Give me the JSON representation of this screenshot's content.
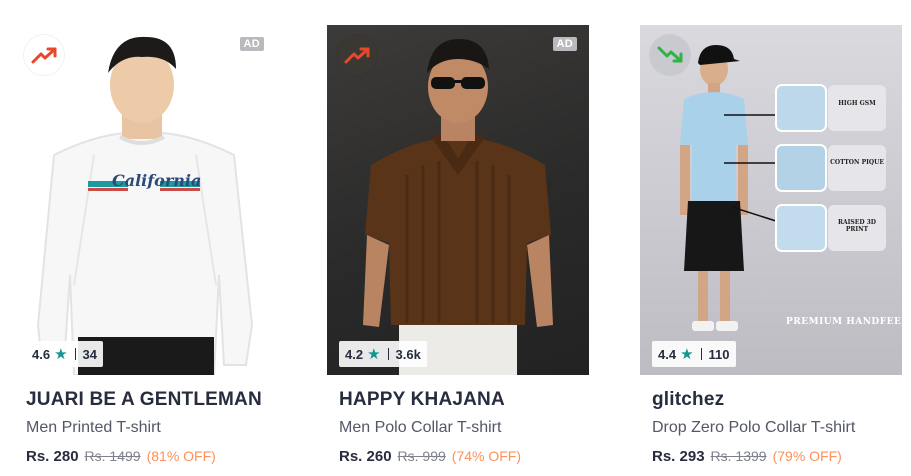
{
  "products": [
    {
      "trend_icon": "trending-up-icon",
      "trend_color": "#e8472c",
      "ad_label": "AD",
      "rating": "4.6",
      "rating_count": "34",
      "brand": "JUARI BE A GENTLEMAN",
      "name": "Men Printed T-shirt",
      "price": "Rs. 280",
      "mrp": "Rs. 1499",
      "discount": "(81% OFF)",
      "print_text": "California"
    },
    {
      "trend_icon": "trending-up-icon",
      "trend_color": "#e8472c",
      "ad_label": "AD",
      "rating": "4.2",
      "rating_count": "3.6k",
      "brand": "HAPPY KHAJANA",
      "name": "Men Polo Collar T-shirt",
      "price": "Rs. 260",
      "mrp": "Rs. 999",
      "discount": "(74% OFF)"
    },
    {
      "trend_icon": "trending-down-icon",
      "trend_color": "#2fb344",
      "rating": "4.4",
      "rating_count": "110",
      "brand": "glitchez",
      "name": "Drop Zero Polo Collar T-shirt",
      "price": "Rs. 293",
      "mrp": "Rs. 1399",
      "discount": "(79% OFF)",
      "callouts": [
        "HIGH GSM",
        "COTTON PIQUE",
        "RAISED 3D PRINT"
      ],
      "banner": "PREMIUM HANDFEEL"
    }
  ],
  "colors": {
    "star": "#14958f",
    "discount": "#ff905a",
    "brand_text": "#282c3f"
  }
}
